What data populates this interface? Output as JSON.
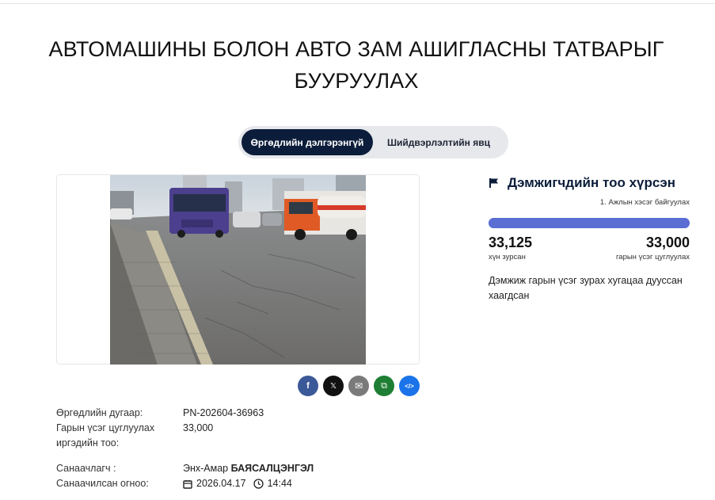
{
  "page": {
    "title": "АВТОМАШИНЫ БОЛОН АВТО ЗАМ АШИГЛАСНЫ ТАТВАРЫГ БУУРУУЛАХ"
  },
  "tabs": [
    {
      "label": "Өргөдлийн дэлгэрэнгүй",
      "active": true
    },
    {
      "label": "Шийдвэрлэлтийн явц",
      "active": false
    }
  ],
  "share": {
    "buttons": [
      {
        "name": "facebook",
        "glyph": "f",
        "color": "#3b5998"
      },
      {
        "name": "x",
        "glyph": "𝕏",
        "color": "#111111"
      },
      {
        "name": "email",
        "glyph": "✉",
        "color": "#7a7a7a"
      },
      {
        "name": "copy",
        "glyph": "⧉",
        "color": "#1e7e34"
      },
      {
        "name": "embed",
        "glyph": "</>",
        "color": "#1a73e8"
      }
    ]
  },
  "details": {
    "petition_number_label": "Өргөдлийн дугаар:",
    "petition_number": "PN-202604-36963",
    "signatures_goal_label_1": "Гарын үсэг цуглуулах",
    "signatures_goal_label_2": "иргэдийн тоо:",
    "signatures_goal": "33,000",
    "initiator_label": "Санаачлагч :",
    "initiator_first": "Энх-Амар",
    "initiator_last": "БАЯСАЛЦЭНГЭЛ",
    "date_label": "Санаачилсан огноо:",
    "date": "2026.04.17",
    "time": "14:44"
  },
  "status": {
    "title": "Дэмжигчдийн тоо хүрсэн",
    "stage": "1. Ажлын хэсэг байгуулах",
    "progress_fraction": 1.0,
    "count": "33,125",
    "count_label": "хүн зурсан",
    "goal": "33,000",
    "goal_label": "гарын үсэг цуглуулах",
    "closed_text": "Дэмжиж гарын үсэг зурах хугацаа дууссан хаагдсан"
  }
}
